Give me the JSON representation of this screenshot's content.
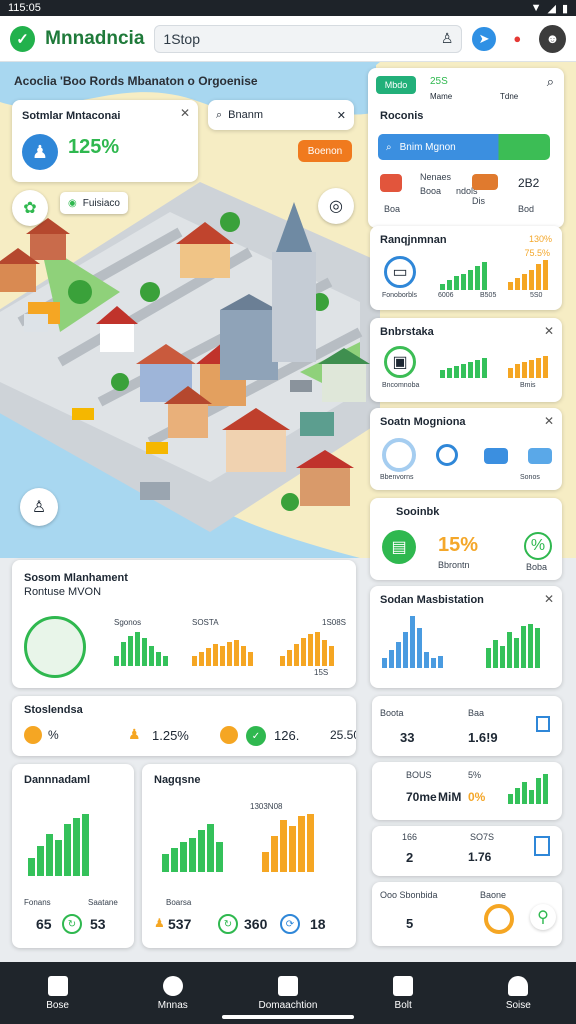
{
  "status": {
    "time": "115:05"
  },
  "app": {
    "title": "Mnnadncia",
    "search_text": "1Stop"
  },
  "map": {
    "title": "Acoclia 'Boo Rords Mbanaton o Orgoenise",
    "stat_card": {
      "title": "Sotmlar Mntaconai",
      "value": "125%"
    },
    "search": {
      "placeholder": "Bnanm"
    },
    "action_button": "Boenon",
    "chip": "Fuisiaco"
  },
  "right_panel": {
    "tabs": [
      "Mbdo",
      "25S",
      "Mame",
      "Tdne"
    ],
    "section1": {
      "title": "Roconis",
      "search": "Bnim Mgnon",
      "items": [
        "Nenaes",
        "Booa",
        "ndols",
        "Dis",
        "2B2"
      ],
      "icon_labels": [
        "Boa",
        "Bod"
      ]
    },
    "section2": {
      "title": "Ranqjnmnan",
      "badge": "130%",
      "value": "75.5%",
      "labels": [
        "Fonoborbls",
        "6006",
        "B505",
        "5S0"
      ]
    },
    "section3": {
      "title": "Bnbrstaka",
      "labels": [
        "Bncomnoba",
        "Bmis"
      ]
    },
    "section4": {
      "title": "Soatn Mogniona",
      "labels": [
        "Bbenvorns",
        "Sonos"
      ]
    },
    "section5": {
      "title": "Sooinbk",
      "value": "15%",
      "sub": "Bbrontn",
      "sub2": "Boba"
    },
    "section6": {
      "title": "Sodan Masbistation"
    },
    "list": [
      {
        "label": "Boota",
        "label2": "Baa",
        "v1": "33",
        "v2": "1.6!9"
      },
      {
        "label": "BOUS",
        "v1": "70me",
        "v2": "MiM",
        "v3": "0%",
        "v4": "5%"
      },
      {
        "label": "166",
        "v1": "2",
        "v2": "1.76",
        "v3": "SO7S"
      },
      {
        "label": "Ooo Sbonbida",
        "v1": "5",
        "v2": "Baone"
      }
    ]
  },
  "bottom_left": {
    "mgmt": {
      "title": "Sosom Mlanhament",
      "subtitle": "Rontuse MVON",
      "labels": [
        "Sgonos",
        "SOSTA",
        "1S08S",
        "15S"
      ]
    },
    "stats": {
      "title": "Stoslendsa",
      "v1": "%",
      "v2": "1.25%",
      "v3": "126.",
      "v4": "25.50"
    },
    "d1": {
      "title": "Dannnadaml",
      "foot1": "Fonans",
      "foot2": "Saatane",
      "v1": "65",
      "v2": "53"
    },
    "d2": {
      "title": "Nagqsne",
      "foot1": "Boarsa",
      "v1": "537",
      "v2": "360",
      "v3": "18",
      "tag": "1303N08"
    }
  },
  "nav": [
    {
      "label": "Bose"
    },
    {
      "label": "Mnnas"
    },
    {
      "label": "Domaachtion"
    },
    {
      "label": "Bolt"
    },
    {
      "label": "Soise"
    }
  ]
}
